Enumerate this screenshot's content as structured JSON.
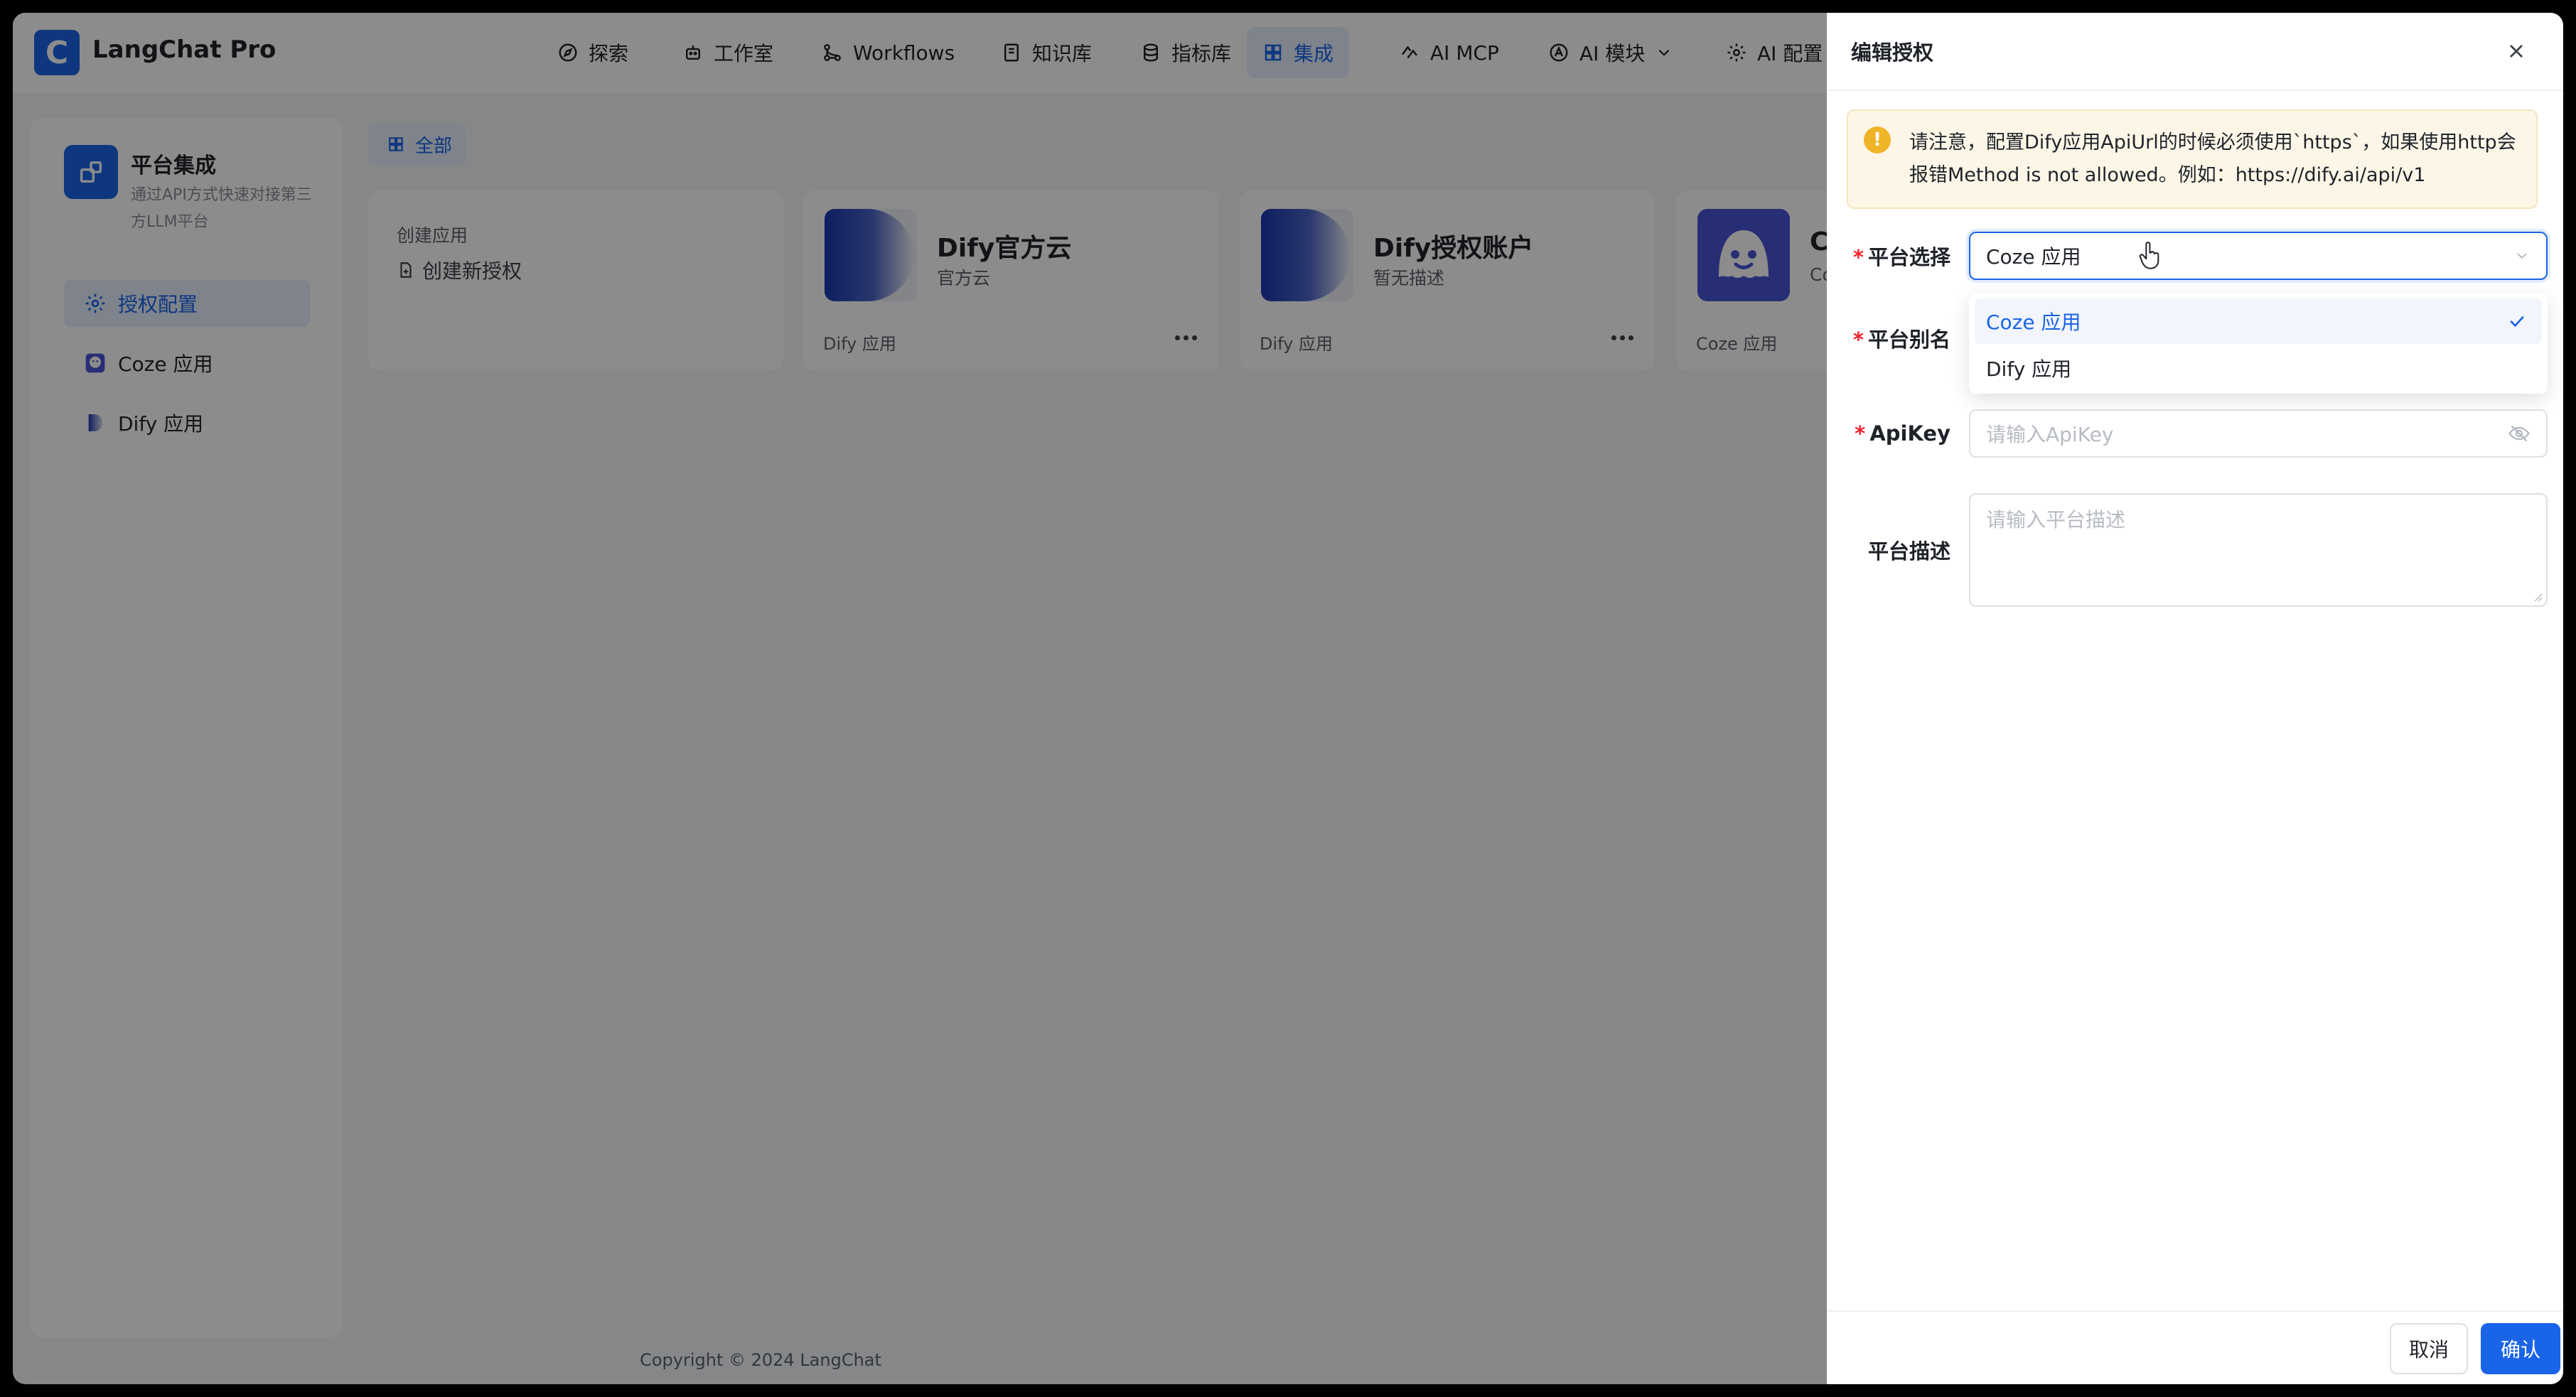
{
  "app": {
    "logo_letter": "C",
    "title": "LangChat Pro"
  },
  "nav": [
    {
      "label": "探索",
      "icon": "compass-icon"
    },
    {
      "label": "工作室",
      "icon": "robot-icon"
    },
    {
      "label": "Workflows",
      "icon": "workflow-icon"
    },
    {
      "label": "知识库",
      "icon": "book-icon"
    },
    {
      "label": "指标库",
      "icon": "database-icon"
    },
    {
      "label": "集成",
      "icon": "grid-icon",
      "active": true
    },
    {
      "label": "AI MCP",
      "icon": "mcp-icon"
    },
    {
      "label": "AI 模块",
      "icon": "module-icon"
    },
    {
      "label": "AI 配置",
      "icon": "gear-icon"
    }
  ],
  "sidebar": {
    "title": "平台集成",
    "desc": "通过API方式快速对接第三方LLM平台",
    "items": [
      {
        "label": "授权配置",
        "active": true
      },
      {
        "label": "Coze 应用"
      },
      {
        "label": "Dify 应用"
      }
    ]
  },
  "filter": {
    "label": "全部"
  },
  "create_card": {
    "title": "创建应用",
    "action": "创建新授权"
  },
  "cards": [
    {
      "name": "Dify官方云",
      "sub": "官方云",
      "type": "Dify 应用"
    },
    {
      "name": "Dify授权账户",
      "sub": "暂无描述",
      "type": "Dify 应用"
    },
    {
      "name": "C",
      "sub": "Co",
      "type": "Coze 应用"
    }
  ],
  "footer": {
    "copyright": "Copyright © 2024 LangChat"
  },
  "drawer": {
    "title": "编辑授权",
    "alert": "请注意，配置Dify应用ApiUrl的时候必须使用`https`，如果使用http会报错Method is not allowed。例如：https://dify.ai/api/v1",
    "fields": {
      "platform": {
        "label": "平台选择",
        "value": "Coze 应用"
      },
      "alias": {
        "label": "平台别名"
      },
      "apikey": {
        "label": "ApiKey",
        "placeholder": "请输入ApiKey"
      },
      "desc": {
        "label": "平台描述",
        "placeholder": "请输入平台描述"
      }
    },
    "dropdown": [
      {
        "label": "Coze 应用",
        "selected": true
      },
      {
        "label": "Dify 应用"
      }
    ],
    "buttons": {
      "cancel": "取消",
      "ok": "确认"
    }
  },
  "colors": {
    "accent": "#1a64e8",
    "warning": "#f0b429",
    "required": "#f5222d"
  }
}
